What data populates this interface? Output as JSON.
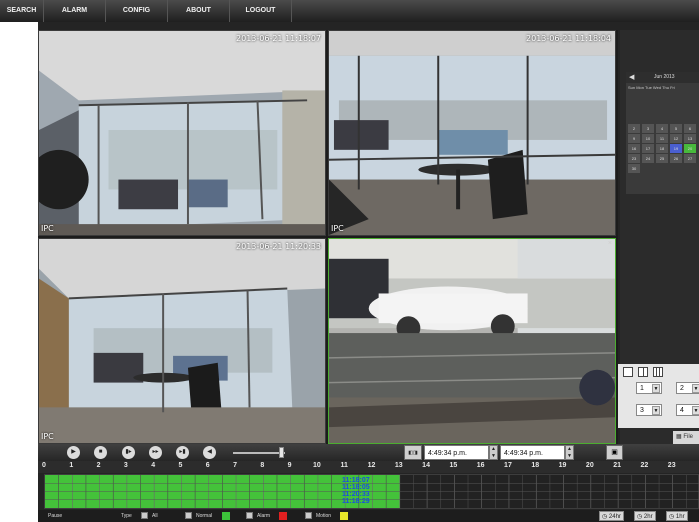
{
  "nav": [
    "SEARCH",
    "ALARM",
    "CONFIG",
    "ABOUT",
    "LOGOUT"
  ],
  "cameras": [
    {
      "timestamp": "2013-06-21 11:18:07",
      "label": "IPC"
    },
    {
      "timestamp": "2013-06-21 11:18:04",
      "label": "IPC"
    },
    {
      "timestamp": "2013-06-21 11:20:33",
      "label": "IPC"
    },
    {
      "timestamp": "",
      "label": "",
      "close": "×"
    }
  ],
  "calendar": {
    "month": "Jun  2013",
    "dow": "Sun Mon Tue Wed Thu Fri",
    "days": [
      "2",
      "3",
      "4",
      "5",
      "6",
      "9",
      "10",
      "11",
      "12",
      "13",
      "16",
      "17",
      "18",
      "19",
      "20",
      "23",
      "24",
      "25",
      "26",
      "27",
      "30"
    ],
    "selected": "19",
    "alarm": "20"
  },
  "layout": {
    "sel1": "1",
    "sel2": "2",
    "sel3": "3",
    "sel4": "4",
    "file": "File"
  },
  "controls": {
    "time_start": "4:49:34 p.m.",
    "time_end": "4:49:34 p.m.",
    "volume_level": 0.92
  },
  "hours": [
    "0",
    "1",
    "2",
    "3",
    "4",
    "5",
    "6",
    "7",
    "8",
    "9",
    "10",
    "11",
    "12",
    "13",
    "14",
    "15",
    "16",
    "17",
    "18",
    "19",
    "20",
    "21",
    "22",
    "23"
  ],
  "timeline": {
    "labels": [
      "11:18:07",
      "11:18:05",
      "11:20:33",
      "11:18:29"
    ],
    "recorded_until_hour": 13
  },
  "legend": {
    "pause": "Pause",
    "type": "Type",
    "all": "All",
    "normal": "Normal",
    "alarm": "Alarm",
    "motion": "Motion",
    "zoom": [
      "24hr",
      "2hr",
      "1hr"
    ]
  },
  "colors": {
    "normal": "#3cc23a",
    "alarm": "#e12020",
    "motion": "#e6e62a",
    "active_border": "#4cae30"
  }
}
